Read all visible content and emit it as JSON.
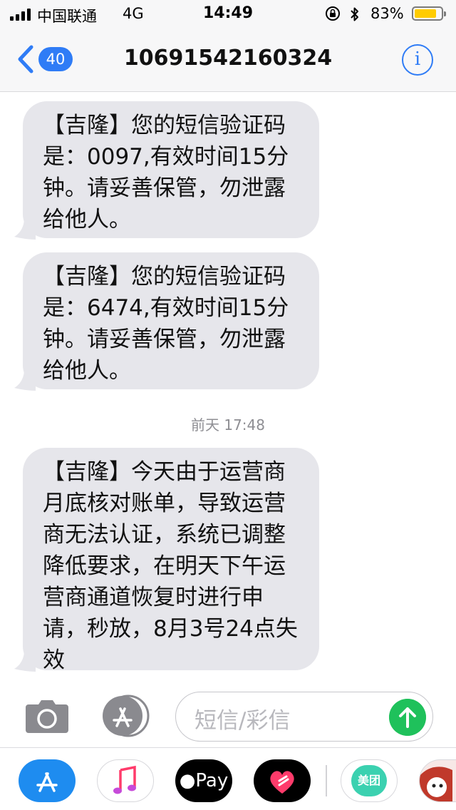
{
  "status_bar": {
    "carrier": "中国联通",
    "network": "4G",
    "time": "14:49",
    "battery_percent_label": "83%",
    "battery_level": 0.83,
    "signal_bars": 4
  },
  "nav": {
    "back_count": "40",
    "title": "10691542160324",
    "info_label": "i"
  },
  "messages": [
    {
      "text": "【吉隆】您的短信验证码是：0097,有效时间15分钟。请妥善保管，勿泄露给他人。"
    },
    {
      "text": "【吉隆】您的短信验证码是：6474,有效时间15分钟。请妥善保管，勿泄露给他人。"
    },
    {
      "timestamp": "前天 17:48"
    },
    {
      "text": "【吉隆】今天由于运营商月底核对账单，导致运营商无法认证，系统已调整降低要求，在明天下午运营商通道恢复时进行申请，秒放，8月3号24点失效"
    }
  ],
  "input": {
    "placeholder": "短信/彩信"
  },
  "app_drawer": {
    "apple_pay_label": "Pay",
    "meituan_label": "美团"
  },
  "colors": {
    "accent": "#2f7cf6",
    "bubble": "#e6e6eb",
    "send": "#1fc15b",
    "battery": "#ffcc00"
  }
}
